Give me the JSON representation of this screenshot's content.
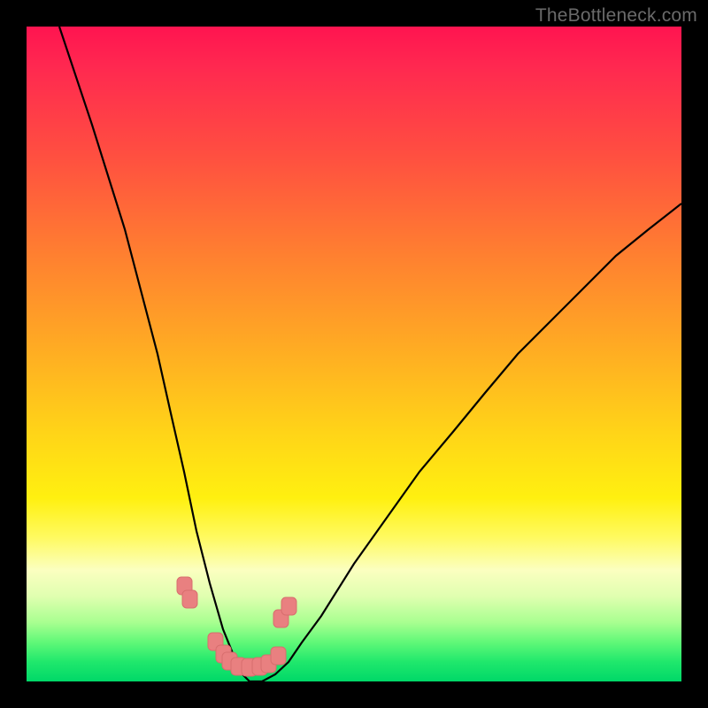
{
  "watermark": {
    "text": "TheBottleneck.com"
  },
  "chart_data": {
    "type": "line",
    "title": "",
    "xlabel": "",
    "ylabel": "",
    "xlim": [
      0,
      100
    ],
    "ylim": [
      0,
      100
    ],
    "grid": false,
    "legend": false,
    "series": [
      {
        "name": "bottleneck-curve",
        "x": [
          5,
          10,
          15,
          20,
          22,
          24,
          26,
          28,
          30,
          32,
          33,
          34,
          35,
          36,
          38,
          40,
          42,
          45,
          50,
          55,
          60,
          65,
          70,
          75,
          80,
          85,
          90,
          95,
          100
        ],
        "values": [
          100,
          85,
          69,
          50,
          41,
          32,
          23,
          15,
          8,
          3,
          1,
          0,
          0,
          0,
          1,
          3,
          6,
          10,
          18,
          25,
          32,
          38,
          44,
          50,
          55,
          60,
          65,
          69,
          73
        ]
      }
    ],
    "markers": {
      "name": "highlight-points",
      "color": "#e57373",
      "x": [
        24.0,
        24.8,
        28.8,
        30.0,
        31.0,
        32.4,
        34.0,
        35.6,
        37.0,
        38.5,
        38.8,
        40.0
      ],
      "values": [
        14.0,
        12.0,
        5.5,
        3.6,
        2.5,
        1.8,
        1.6,
        1.7,
        2.2,
        3.4,
        9.0,
        11.0
      ]
    },
    "background": {
      "type": "vertical-gradient",
      "stops": [
        {
          "pct": 0,
          "color": "#ff1450"
        },
        {
          "pct": 50,
          "color": "#ffa824"
        },
        {
          "pct": 78,
          "color": "#fffa60"
        },
        {
          "pct": 100,
          "color": "#00d868"
        }
      ]
    }
  }
}
